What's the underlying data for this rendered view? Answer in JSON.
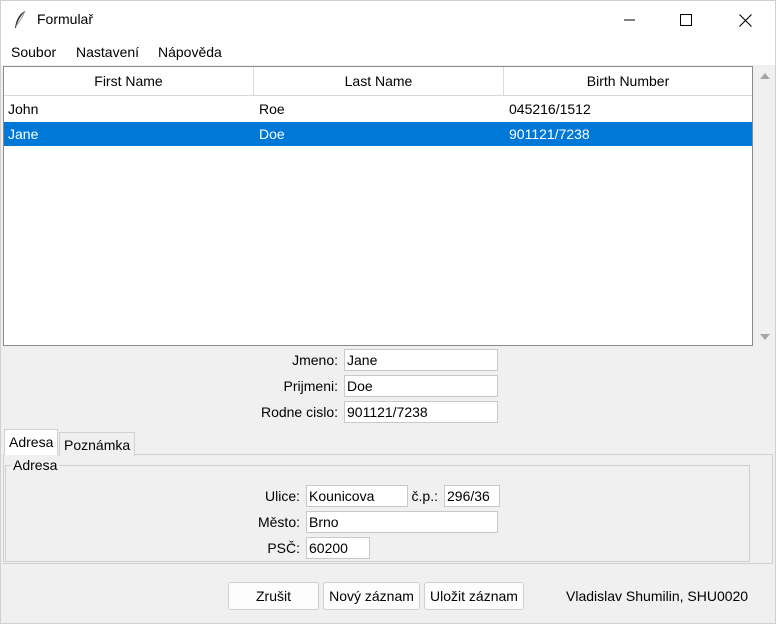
{
  "window": {
    "title": "Formulař"
  },
  "menu": [
    "Soubor",
    "Nastavení",
    "Nápověda"
  ],
  "table": {
    "columns": [
      "First Name",
      "Last Name",
      "Birth Number"
    ],
    "rows": [
      {
        "first": "John",
        "last": "Roe",
        "birth": "045216/1512",
        "selected": false
      },
      {
        "first": "Jane",
        "last": "Doe",
        "birth": "901121/7238",
        "selected": true
      }
    ]
  },
  "form": {
    "jmeno_label": "Jmeno:",
    "jmeno_value": "Jane",
    "prijmeni_label": "Prijmeni:",
    "prijmeni_value": "Doe",
    "rodne_label": "Rodne cislo:",
    "rodne_value": "901121/7238"
  },
  "tabs": {
    "adresa": "Adresa",
    "poznamka": "Poznámka"
  },
  "address": {
    "group_title": "Adresa",
    "ulice_label": "Ulice:",
    "ulice_value": "Kounicova",
    "cp_label": "č.p.:",
    "cp_value": "296/36",
    "mesto_label": "Město:",
    "mesto_value": "Brno",
    "psc_label": "PSČ:",
    "psc_value": "60200"
  },
  "buttons": {
    "cancel": "Zrušit",
    "new": "Nový záznam",
    "save": "Uložit záznam"
  },
  "author": "Vladislav Shumilin, SHU0020",
  "colors": {
    "selection": "#0078d7"
  }
}
